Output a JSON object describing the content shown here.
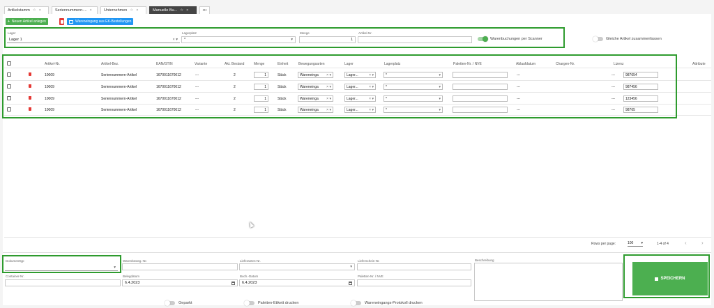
{
  "tabs": [
    {
      "label": "Artikelstamm",
      "star": "☆",
      "close": "×"
    },
    {
      "label": "Seriennummern-...",
      "star": "",
      "close": "×"
    },
    {
      "label": "Unternehmen",
      "star": "☆",
      "close": "×"
    },
    {
      "label": "Manuelle Bu...",
      "star": "☆",
      "close": "×"
    },
    {
      "label": "•••"
    }
  ],
  "toolbar": {
    "new_article": "Neuen Artikel anlegen",
    "goods_receipt": "Wareneingang aus EK-Bestellungen"
  },
  "filter": {
    "lager_label": "Lager",
    "lager_value": "Lager 1",
    "lagerplatz_label": "Lagerplatz",
    "lagerplatz_value": "*",
    "menge_label": "Menge",
    "menge_value": "1",
    "artikel_nr_label": "Artikel-Nr.",
    "artikel_nr_value": "",
    "scanner_label": "Warenbuchungen per Scanner",
    "merge_label": "Gleiche Artikel zusammenfassen"
  },
  "table": {
    "headers": [
      "Artikel-Nr.",
      "Artikel-Bez.",
      "EAN/GTIN",
      "Variante",
      "Akt. Bestand",
      "Menge",
      "Einheit",
      "Bewegungsarten",
      "Lager",
      "Lagerplatz",
      "Paletten-Nr. / NVE",
      "Ablaufdatum",
      "Chargen-Nr.",
      "Lizenz",
      "Attribute"
    ],
    "rows": [
      {
        "nr": "10009",
        "bez": "Seriennummern-Artikel",
        "ean": "1670011670012",
        "variante": "---",
        "bestand": "2",
        "menge": "1",
        "einheit": "Stück",
        "bewegung": "Wareneinga",
        "lager": "Lager...",
        "platz": "*",
        "palette": "",
        "ablauf": "---",
        "charge": "---",
        "lizenz": "987654"
      },
      {
        "nr": "10009",
        "bez": "Seriennummern-Artikel",
        "ean": "1670011670012",
        "variante": "---",
        "bestand": "2",
        "menge": "1",
        "einheit": "Stück",
        "bewegung": "Wareneinga",
        "lager": "Lager...",
        "platz": "*",
        "palette": "",
        "ablauf": "---",
        "charge": "---",
        "lizenz": "987456"
      },
      {
        "nr": "10009",
        "bez": "Seriennummern-Artikel",
        "ean": "1670011670012",
        "variante": "---",
        "bestand": "2",
        "menge": "1",
        "einheit": "Stück",
        "bewegung": "Wareneinga",
        "lager": "Lager...",
        "platz": "*",
        "palette": "",
        "ablauf": "---",
        "charge": "---",
        "lizenz": "123456"
      },
      {
        "nr": "10009",
        "bez": "Seriennummern-Artikel",
        "ean": "1670011670012",
        "variante": "---",
        "bestand": "2",
        "menge": "1",
        "einheit": "Stück",
        "bewegung": "Wareneinga",
        "lager": "Lager...",
        "platz": "*",
        "palette": "",
        "ablauf": "---",
        "charge": "---",
        "lizenz": "98765"
      }
    ]
  },
  "pagination": {
    "rows_label": "Rows per page:",
    "rows_value": "100",
    "range": "1-4 of 4",
    "prev": "‹",
    "next": "›"
  },
  "bottom": {
    "dokumenttyp": "Dokumenttyp",
    "warenbeweg": "Warenbeweg.-Nr.",
    "lieferanten": "Lieferanten-Nr.",
    "lieferschein": "Lieferschein-Nr.",
    "beschreibung": "Beschreibung",
    "container": "Container-Nr.",
    "belegdatum_label": "Belegdatum",
    "belegdatum": "6.4.2023",
    "buchdatum_label": "Buch.-Datum",
    "buchdatum": "6.4.2023",
    "palette": "Paletten-Nr. / NVE",
    "geparkt": "Geparkt",
    "etikett": "Paletten-Etikett drucken",
    "protokoll": "Wareneingangs-Protokoll drucken",
    "save": "SPEICHERN"
  }
}
